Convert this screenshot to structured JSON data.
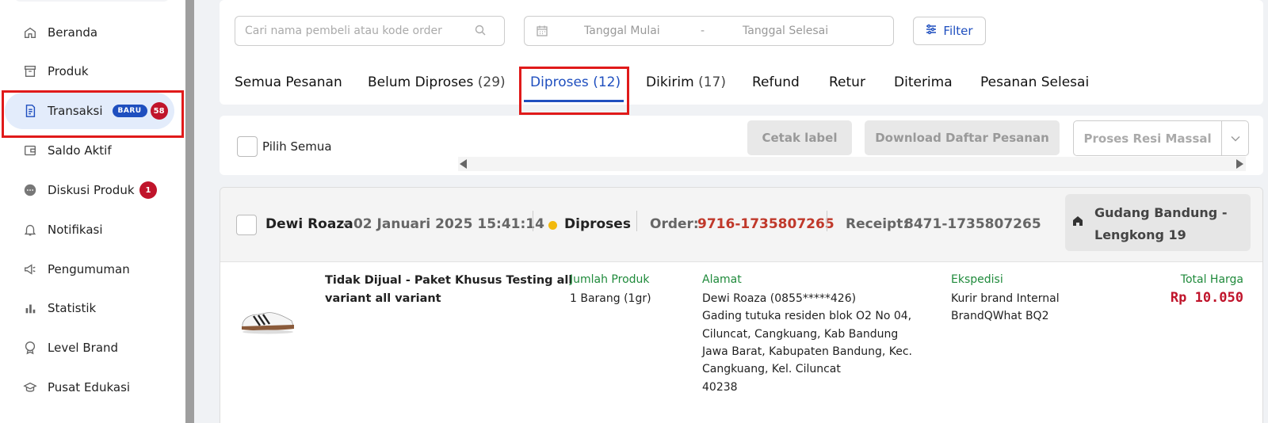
{
  "sidebar": {
    "items": [
      {
        "label": "Beranda",
        "icon": "home-icon"
      },
      {
        "label": "Produk",
        "icon": "box-icon"
      },
      {
        "label": "Transaksi",
        "icon": "receipt-icon",
        "badge_new": "BARU",
        "badge_count": "58",
        "active": true
      },
      {
        "label": "Saldo Aktif",
        "icon": "wallet-icon"
      },
      {
        "label": "Diskusi Produk",
        "icon": "chat-icon",
        "badge_count": "1"
      },
      {
        "label": "Notifikasi",
        "icon": "bell-icon"
      },
      {
        "label": "Pengumuman",
        "icon": "megaphone-icon"
      },
      {
        "label": "Statistik",
        "icon": "bar-chart-icon"
      },
      {
        "label": "Level Brand",
        "icon": "medal-icon"
      },
      {
        "label": "Pusat Edukasi",
        "icon": "graduation-cap-icon"
      }
    ]
  },
  "filters": {
    "search_placeholder": "Cari nama pembeli atau kode order",
    "date_start": "Tanggal Mulai",
    "date_separator": "-",
    "date_end": "Tanggal Selesai",
    "filter_label": "Filter"
  },
  "tabs": [
    {
      "label": "Semua Pesanan",
      "count": ""
    },
    {
      "label": "Belum Diproses",
      "count": "(29)"
    },
    {
      "label": "Diproses",
      "count": "(12)",
      "active": true
    },
    {
      "label": "Dikirim",
      "count": "(17)"
    },
    {
      "label": "Refund",
      "count": ""
    },
    {
      "label": "Retur",
      "count": ""
    },
    {
      "label": "Diterima",
      "count": ""
    },
    {
      "label": "Pesanan Selesai",
      "count": ""
    }
  ],
  "toolbar": {
    "select_all": "Pilih Semua",
    "print_label": "Cetak label",
    "download_list": "Download Daftar Pesanan",
    "bulk_receipt": "Proses Resi Massal"
  },
  "order": {
    "buyer": "Dewi Roaza",
    "date": "- 02 Januari 2025 15:41:14",
    "status": "Diproses",
    "order_label": "Order:",
    "order_code": "9716-1735807265",
    "receipt_label": "Receipt:",
    "receipt_code": "8471-1735807265",
    "warehouse_line1": "Gudang Bandung -",
    "warehouse_line2": "Lengkong 19",
    "product_name_line1": "Tidak Dijual - Paket Khusus Testing all",
    "product_name_line2": "variant all variant",
    "qty_header": "Jumlah Produk",
    "qty_value": "1 Barang (1gr)",
    "address_header": "Alamat",
    "address_lines": [
      "Dewi Roaza (0855*****426)",
      "Gading tutuka residen blok O2 No 04,",
      "Ciluncat, Cangkuang, Kab Bandung",
      "Jawa Barat, Kabupaten Bandung, Kec.",
      "Cangkuang, Kel. Ciluncat",
      "40238"
    ],
    "courier_header": "Ekspedisi",
    "courier_line1": "Kurir brand Internal",
    "courier_line2": "BrandQWhat BQ2",
    "total_header": "Total Harga",
    "total_value": "Rp 10.050"
  },
  "colors": {
    "accent": "#1f4fbf",
    "danger": "#c0142b",
    "success": "#1f8a3b",
    "highlight_box": "#e01a1a"
  }
}
